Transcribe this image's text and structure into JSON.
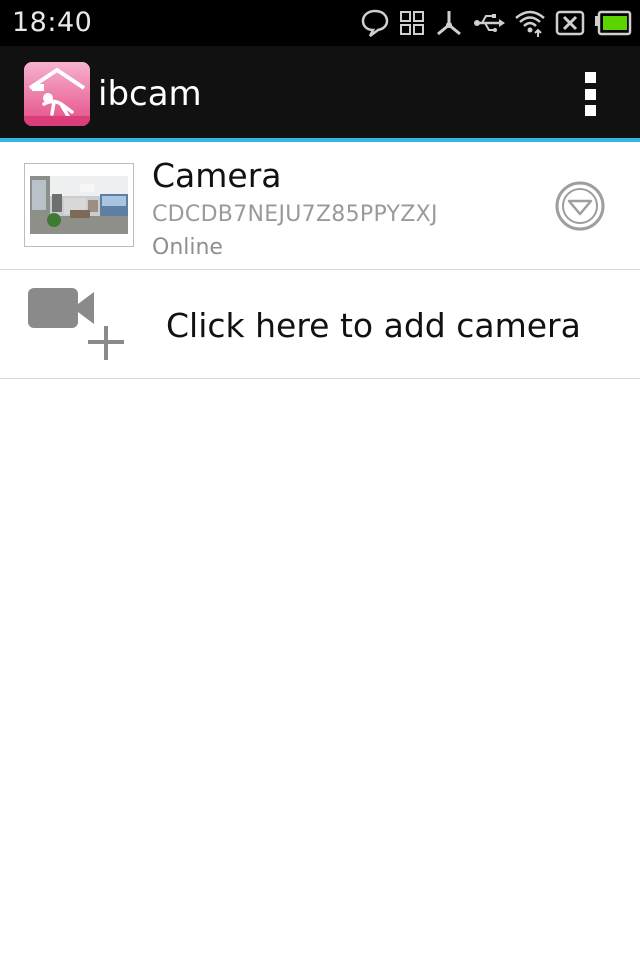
{
  "status_bar": {
    "time": "18:40",
    "icons": [
      "chat-bubble-icon",
      "apps-grid-icon",
      "usb-debug-icon",
      "usb-icon",
      "wifi-icon",
      "sim-missing-icon",
      "battery-icon"
    ]
  },
  "action_bar": {
    "app_title": "ibcam",
    "app_icon": "ibcam-logo-icon",
    "menu_icon": "overflow-menu-icon"
  },
  "cameras": [
    {
      "name": "Camera",
      "id": "CDCDB7NEJU7Z85PPYZXJ",
      "status": "Online",
      "action_icon": "expand-down-icon"
    }
  ],
  "add_camera": {
    "label": "Click here to add camera",
    "icon": "add-video-camera-icon"
  },
  "colors": {
    "accent": "#33b5e5",
    "action_bar_bg": "#111111",
    "status_bar_bg": "#000000",
    "logo_pink": "#e9548e",
    "battery_green": "#5bd400"
  }
}
